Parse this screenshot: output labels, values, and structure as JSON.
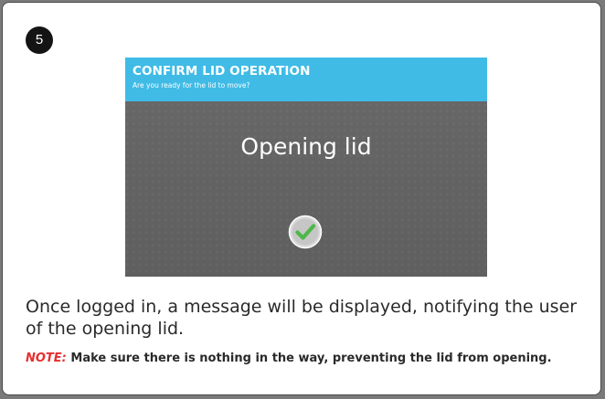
{
  "step": {
    "number": "5"
  },
  "screen": {
    "header_title": "CONFIRM LID OPERATION",
    "header_subtitle": "Are you ready for the lid to move?",
    "message": "Opening lid",
    "status_icon": "check-circle-icon"
  },
  "instructions": {
    "text": "Once logged in, a message will be displayed, notifying the user of the opening lid.",
    "note_label": "NOTE:",
    "note_text": " Make sure there is nothing in the way, preventing the lid from opening."
  },
  "colors": {
    "header_blue": "#3fbbe6",
    "screen_gray": "#646464",
    "check_green": "#4cb848",
    "note_red": "#e62f2f",
    "badge_black": "#141414"
  }
}
